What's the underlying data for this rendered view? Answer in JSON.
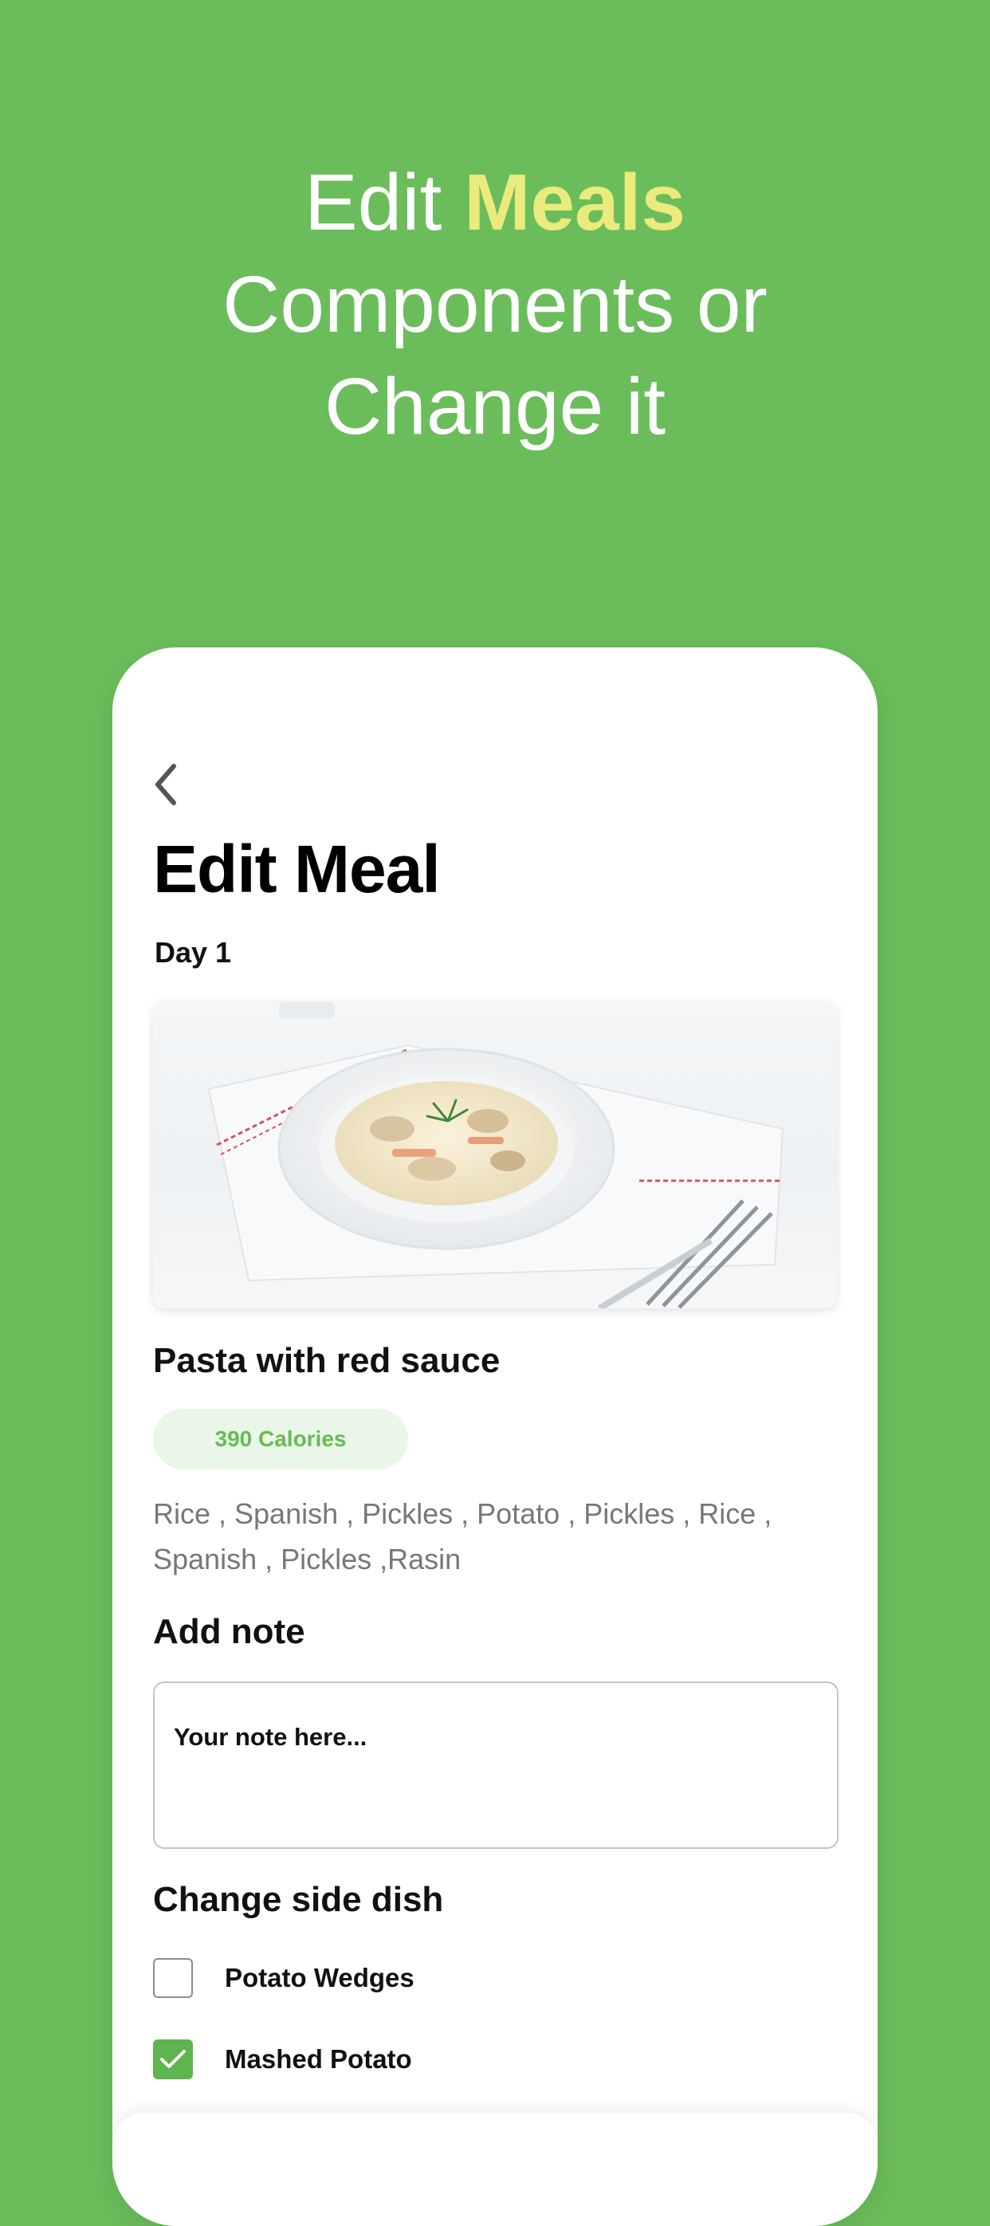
{
  "headline": {
    "line1_prefix": "Edit ",
    "line1_accent": "Meals",
    "line2": "Components or",
    "line3": "Change it"
  },
  "screen": {
    "back_icon": "chevron-left-icon",
    "title": "Edit Meal",
    "day": "Day 1",
    "meal_name": "Pasta with red sauce",
    "calories": "390 Calories",
    "ingredients": "Rice , Spanish , Pickles , Potato , Pickles , Rice , Spanish , Pickles ,Rasin",
    "note_label": "Add note",
    "note_placeholder": "Your note here...",
    "side_dish_label": "Change side dish",
    "side_dishes": [
      {
        "label": "Potato Wedges",
        "checked": false
      },
      {
        "label": "Mashed Potato",
        "checked": true
      }
    ]
  },
  "colors": {
    "background": "#6bbd5b",
    "accent_yellow": "#eaeb7c",
    "calorie_text": "#67bb56",
    "calorie_pill": "#eaf6e7",
    "checkbox_checked": "#5eb54d"
  }
}
